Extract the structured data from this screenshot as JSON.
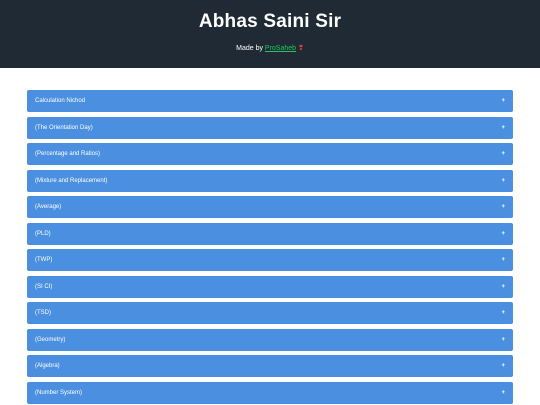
{
  "header": {
    "title": "Abhas Saini Sir",
    "made_by_prefix": "Made by ",
    "made_by_link": "ProSaheb",
    "heart": "❣"
  },
  "accordion": {
    "items": [
      {
        "label": "Calculation Nichod",
        "toggle": "+"
      },
      {
        "label": "(The Orientation Day)",
        "toggle": "+"
      },
      {
        "label": "(Percentage and Ratios)",
        "toggle": "+"
      },
      {
        "label": "(Mixture and Replacement)",
        "toggle": "+"
      },
      {
        "label": "(Average)",
        "toggle": "+"
      },
      {
        "label": "(PLD)",
        "toggle": "+"
      },
      {
        "label": "(TWP)",
        "toggle": "+"
      },
      {
        "label": "(SI CI)",
        "toggle": "+"
      },
      {
        "label": "(TSD)",
        "toggle": "+"
      },
      {
        "label": "(Geometry)",
        "toggle": "+"
      },
      {
        "label": "(Algebra)",
        "toggle": "+"
      },
      {
        "label": "(Number System)",
        "toggle": "+"
      }
    ]
  },
  "colors": {
    "header_bg": "#1f2a35",
    "accordion_bg": "#4a8fe0",
    "link": "#22c55e",
    "heart": "#e53e3e"
  }
}
